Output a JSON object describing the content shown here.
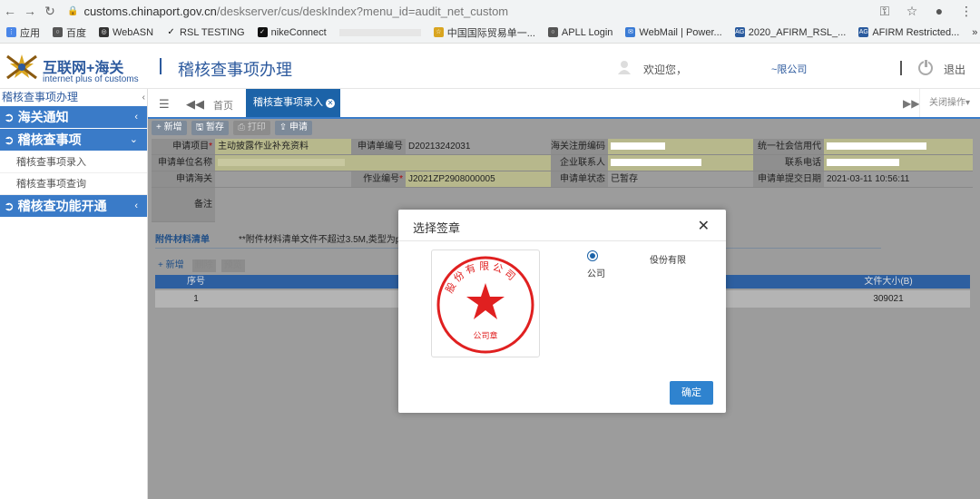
{
  "browser": {
    "url_host": "customs.chinaport.gov.cn",
    "url_path": "/deskserver/cus/deskIndex?menu_id=audit_net_custom",
    "bookmarks": [
      "应用",
      "百度",
      "WebASN",
      "RSL TESTING",
      "nikeConnect",
      "中国国际贸易单一...",
      "APLL Login",
      "WebMail | Power...",
      "2020_AFIRM_RSL_...",
      "AFIRM Restricted..."
    ]
  },
  "header": {
    "logo_cn": "互联网+海关",
    "logo_en": "internet plus of customs",
    "system_title": "稽核查事项办理",
    "welcome": "欢迎您，",
    "company": "~限公司",
    "logout": "退出"
  },
  "sidebar": {
    "title": "稽核查事项办理",
    "collapse": "‹",
    "sections": [
      {
        "label": "海关通知",
        "arrow": "‹"
      },
      {
        "label": "稽核查事项",
        "arrow": "⌄"
      },
      {
        "label": "稽核查功能开通",
        "arrow": "‹"
      }
    ],
    "sub_items": [
      "稽核查事项录入",
      "稽核查事项查询"
    ]
  },
  "tabs": {
    "home": "首页",
    "active": "稽核查事项录入",
    "close_ops": "关闭操作▾"
  },
  "toolbar": {
    "new": "+ 新增",
    "save": "暂存",
    "print": "打印",
    "submit": "申请"
  },
  "form": {
    "apply_item_label": "申请项目",
    "apply_item_value": "主动披露作业补充资料",
    "apply_no_label": "申请单编号",
    "apply_no_value": "D20213242031",
    "customs_reg_label": "海关注册编码",
    "credit_code_label": "统一社会信用代码",
    "apply_unit_label": "申请单位名称",
    "contact_label": "企业联系人",
    "phone_label": "联系电话",
    "apply_customs_label": "申请海关",
    "job_no_label": "作业编号",
    "job_no_value": "J2021ZP2908000005",
    "status_label": "申请单状态",
    "status_value": "已暂存",
    "submit_date_label": "申请单提交日期",
    "submit_date_value": "2021-03-11 10:56:11",
    "remark_label": "备注"
  },
  "attachments": {
    "title": "附件材料清单",
    "note": "**附件材料清单文件不超过3.5M,类型为p",
    "add": "+ 新增",
    "delete": "删除",
    "preview": "预览",
    "col_seq": "序号",
    "col_size": "文件大小(B)",
    "rows": [
      {
        "seq": "1",
        "size": "309021"
      }
    ]
  },
  "modal": {
    "title": "选择签章",
    "close": "✕",
    "radio_label": "公司",
    "company_text": "伇份有限",
    "seal_top_text": "股份有限公司",
    "seal_bottom_text": "公司章",
    "confirm": "确定"
  },
  "colors": {
    "brand": "#2d5a9e",
    "sidebar_section": "#3a7bc8",
    "active_tab": "#1c63a8",
    "seal_red": "#e02020",
    "confirm": "#2f83cf"
  }
}
